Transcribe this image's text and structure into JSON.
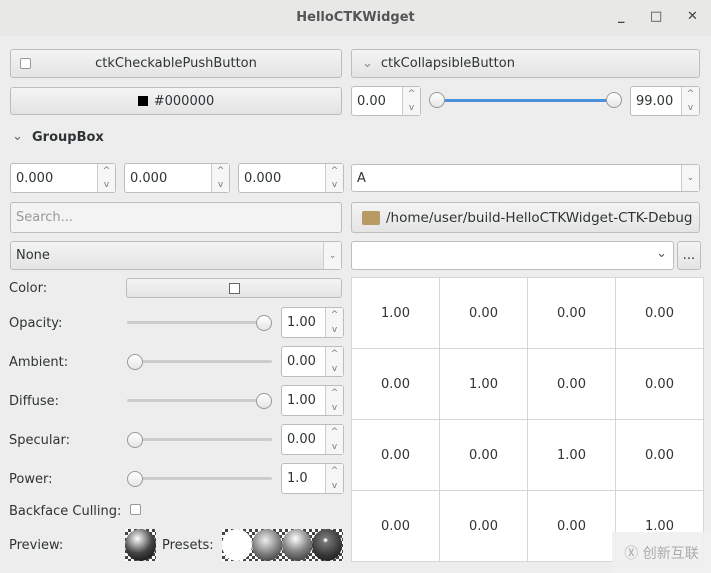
{
  "window": {
    "title": "HelloCTKWidget",
    "minimize": "_",
    "maximize": "□",
    "close": "✕"
  },
  "checkable_button": {
    "label": "ctkCheckablePushButton",
    "checked": false
  },
  "collapsible_button": {
    "label": "ctkCollapsibleButton",
    "arrow": "⌄"
  },
  "color_button": {
    "label": "#000000",
    "color": "#000000"
  },
  "range": {
    "min_value": "0.00",
    "max_value": "99.00",
    "low_fraction": 0,
    "high_fraction": 1
  },
  "groupbox": {
    "label": "GroupBox"
  },
  "coords": [
    "0.000",
    "0.000",
    "0.000"
  ],
  "combo_a": {
    "value": "A"
  },
  "search": {
    "placeholder": "Search..."
  },
  "path_button": {
    "label": "/home/user/build-HelloCTKWidget-CTK-Debug"
  },
  "none_combo": {
    "value": "None"
  },
  "empty_combo": {
    "value": "",
    "more": "..."
  },
  "matrix": [
    [
      "1.00",
      "0.00",
      "0.00",
      "0.00"
    ],
    [
      "0.00",
      "1.00",
      "0.00",
      "0.00"
    ],
    [
      "0.00",
      "0.00",
      "1.00",
      "0.00"
    ],
    [
      "0.00",
      "0.00",
      "0.00",
      "1.00"
    ]
  ],
  "props": {
    "color_label": "Color:",
    "opacity": {
      "label": "Opacity:",
      "value": "1.00",
      "fraction": 1
    },
    "ambient": {
      "label": "Ambient:",
      "value": "0.00",
      "fraction": 0
    },
    "diffuse": {
      "label": "Diffuse:",
      "value": "1.00",
      "fraction": 1
    },
    "specular": {
      "label": "Specular:",
      "value": "0.00",
      "fraction": 0
    },
    "power": {
      "label": "Power:",
      "value": "1.0",
      "fraction": 0
    },
    "backface_label": "Backface Culling:",
    "preview_label": "Preview:",
    "presets_label": "Presets:"
  },
  "watermark": "创新互联"
}
